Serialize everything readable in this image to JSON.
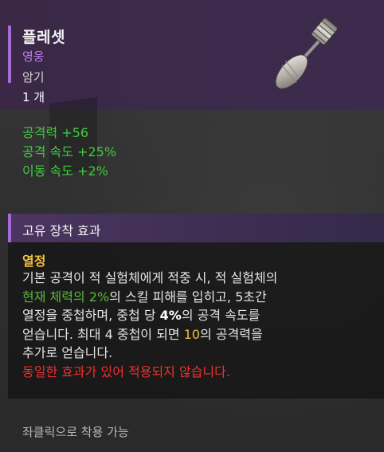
{
  "item": {
    "name": "플레셋",
    "rarity": "영웅",
    "category": "암기",
    "count": "1 개"
  },
  "stats": [
    "공격력 +56",
    "공격 속도 +25%",
    "이동 속도 +2%"
  ],
  "unique_effect": {
    "section_title": "고유 장착 효과",
    "name": "열정",
    "line1": "기본 공격이 적 실험체에게 적중 시, 적 실험체의",
    "line2_highlight": "현재 체력의 2%",
    "line2_rest": "의 스킬 피해를 입히고, 5초간",
    "line3_a": "열정을 중첩하며, 중첩 당 ",
    "line3_bold": "4%",
    "line3_b": "의 공격 속도를",
    "line4_a": "얻습니다. 최대 4 중첩이 되면 ",
    "line4_highlight": "10",
    "line4_b": "의 공격력을",
    "line5": "추가로 얻습니다.",
    "warning": "동일한 효과가 있어 적용되지 않습니다."
  },
  "footer": "좌클릭으로 착용 가능",
  "colors": {
    "rarity": "#c07ef0",
    "stat": "#3fcc3f",
    "effect_name": "#f2c23a",
    "warning": "#f03030",
    "accent": "#a46ad6"
  },
  "icon": "flechette-dart-icon"
}
